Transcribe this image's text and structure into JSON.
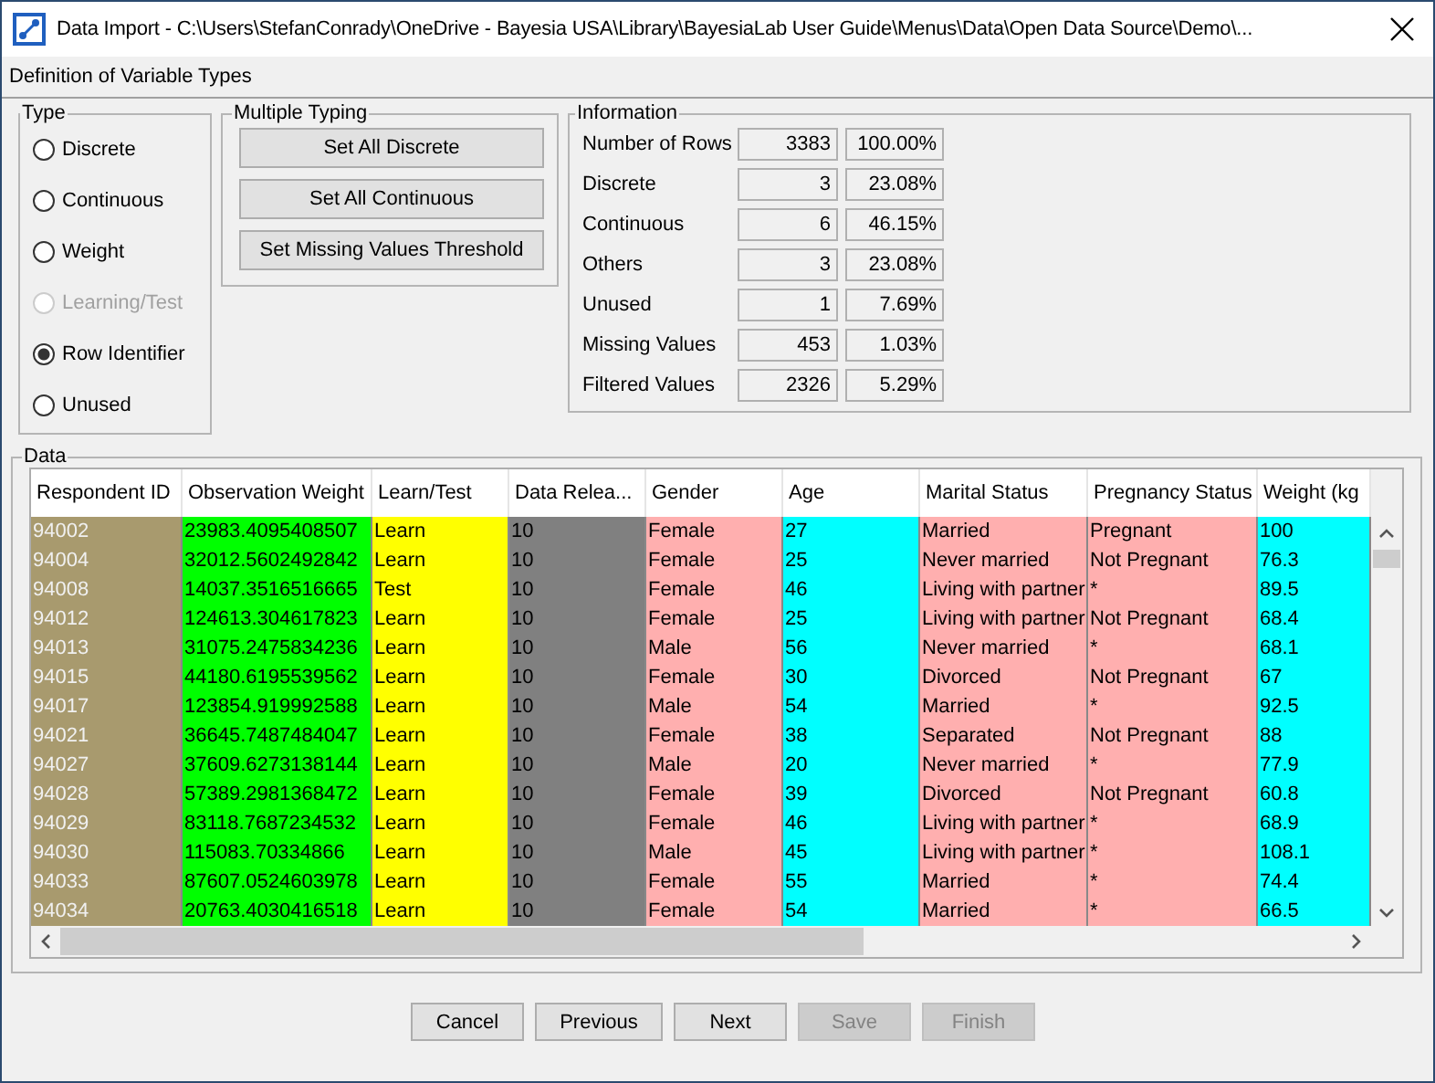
{
  "window": {
    "title": "Data Import - C:\\Users\\StefanConrady\\OneDrive - Bayesia USA\\Library\\BayesiaLab User Guide\\Menus\\Data\\Open Data Source\\Demo\\..."
  },
  "step_title": "Definition of Variable Types",
  "type_group": {
    "title": "Type",
    "options": [
      {
        "label": "Discrete",
        "selected": false,
        "disabled": false
      },
      {
        "label": "Continuous",
        "selected": false,
        "disabled": false
      },
      {
        "label": "Weight",
        "selected": false,
        "disabled": false
      },
      {
        "label": "Learning/Test",
        "selected": false,
        "disabled": true
      },
      {
        "label": "Row Identifier",
        "selected": true,
        "disabled": false
      },
      {
        "label": "Unused",
        "selected": false,
        "disabled": false
      }
    ]
  },
  "multiple_typing": {
    "title": "Multiple Typing",
    "buttons": [
      "Set All Discrete",
      "Set All Continuous",
      "Set Missing Values Threshold"
    ]
  },
  "information": {
    "title": "Information",
    "rows": [
      {
        "label": "Number of Rows",
        "count": "3383",
        "percent": "100.00%"
      },
      {
        "label": "Discrete",
        "count": "3",
        "percent": "23.08%"
      },
      {
        "label": "Continuous",
        "count": "6",
        "percent": "46.15%"
      },
      {
        "label": "Others",
        "count": "3",
        "percent": "23.08%"
      },
      {
        "label": "Unused",
        "count": "1",
        "percent": "7.69%"
      },
      {
        "label": "Missing Values",
        "count": "453",
        "percent": "1.03%"
      },
      {
        "label": "Filtered Values",
        "count": "2326",
        "percent": "5.29%"
      }
    ]
  },
  "data": {
    "title": "Data",
    "table": {
      "columns": [
        {
          "label": "Respondent ID",
          "color": "#a89a6e",
          "kind": "identifier"
        },
        {
          "label": "Observation Weight",
          "color": "#00ff00",
          "kind": "variable"
        },
        {
          "label": "Learn/Test",
          "color": "#ffff00",
          "kind": "variable"
        },
        {
          "label": "Data Relea...",
          "color": "#808080",
          "kind": "variable"
        },
        {
          "label": "Gender",
          "color": "#ffafaf",
          "kind": "variable"
        },
        {
          "label": "Age",
          "color": "#00ffff",
          "kind": "variable"
        },
        {
          "label": "Marital Status",
          "color": "#ffafaf",
          "kind": "variable"
        },
        {
          "label": "Pregnancy Status",
          "color": "#ffafaf",
          "kind": "variable"
        },
        {
          "label": "Weight (kg",
          "color": "#00ffff",
          "kind": "variable"
        }
      ],
      "rows": [
        [
          "94002",
          "23983.4095408507",
          "Learn",
          "10",
          "Female",
          "27",
          "Married",
          "Pregnant",
          "100"
        ],
        [
          "94004",
          "32012.5602492842",
          "Learn",
          "10",
          "Female",
          "25",
          "Never married",
          "Not Pregnant",
          "76.3"
        ],
        [
          "94008",
          "14037.3516516665",
          "Test",
          "10",
          "Female",
          "46",
          "Living with partner",
          "*",
          "89.5"
        ],
        [
          "94012",
          "124613.304617823",
          "Learn",
          "10",
          "Female",
          "25",
          "Living with partner",
          "Not Pregnant",
          "68.4"
        ],
        [
          "94013",
          "31075.2475834236",
          "Learn",
          "10",
          "Male",
          "56",
          "Never married",
          "*",
          "68.1"
        ],
        [
          "94015",
          "44180.6195539562",
          "Learn",
          "10",
          "Female",
          "30",
          "Divorced",
          "Not Pregnant",
          "67"
        ],
        [
          "94017",
          "123854.919992588",
          "Learn",
          "10",
          "Male",
          "54",
          "Married",
          "*",
          "92.5"
        ],
        [
          "94021",
          "36645.7487484047",
          "Learn",
          "10",
          "Female",
          "38",
          "Separated",
          "Not Pregnant",
          "88"
        ],
        [
          "94027",
          "37609.6273138144",
          "Learn",
          "10",
          "Male",
          "20",
          "Never married",
          "*",
          "77.9"
        ],
        [
          "94028",
          "57389.2981368472",
          "Learn",
          "10",
          "Female",
          "39",
          "Divorced",
          "Not Pregnant",
          "60.8"
        ],
        [
          "94029",
          "83118.7687234532",
          "Learn",
          "10",
          "Female",
          "46",
          "Living with partner",
          "*",
          "68.9"
        ],
        [
          "94030",
          "115083.70334866",
          "Learn",
          "10",
          "Male",
          "45",
          "Living with partner",
          "*",
          "108.1"
        ],
        [
          "94033",
          "87607.0524603978",
          "Learn",
          "10",
          "Female",
          "55",
          "Married",
          "*",
          "74.4"
        ],
        [
          "94034",
          "20763.4030416518",
          "Learn",
          "10",
          "Female",
          "54",
          "Married",
          "*",
          "66.5"
        ]
      ]
    }
  },
  "footer_buttons": [
    {
      "label": "Cancel",
      "disabled": false
    },
    {
      "label": "Previous",
      "disabled": false
    },
    {
      "label": "Next",
      "disabled": false
    },
    {
      "label": "Save",
      "disabled": true
    },
    {
      "label": "Finish",
      "disabled": true
    }
  ]
}
